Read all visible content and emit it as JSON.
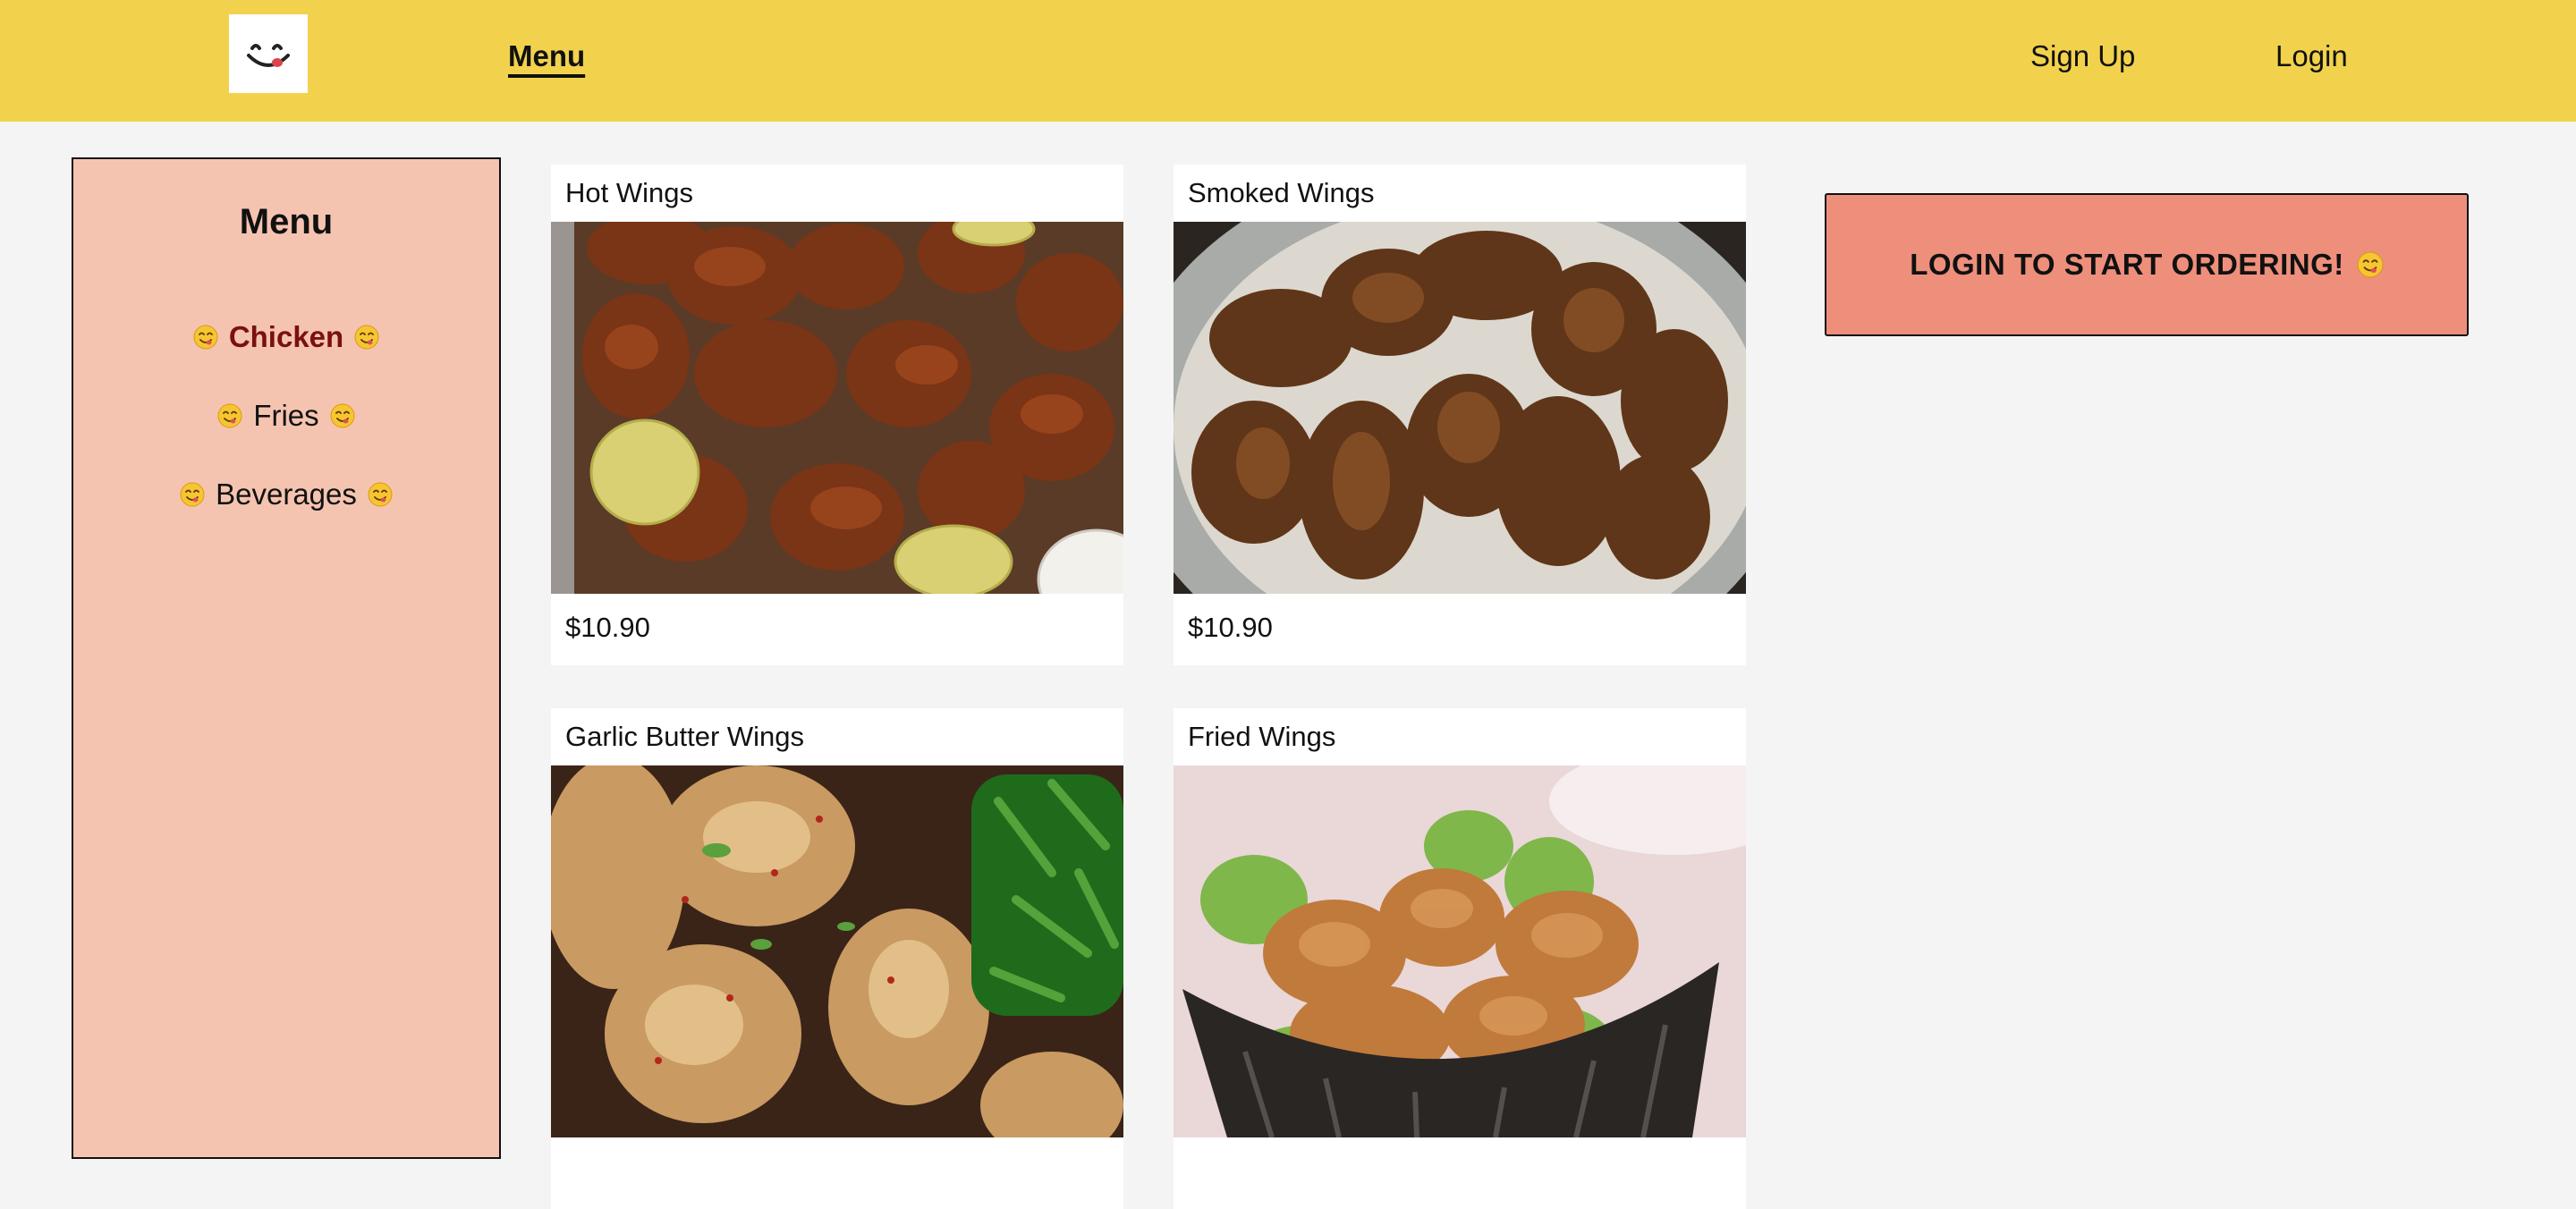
{
  "header": {
    "logo_icon": "smiling-face-logo-icon",
    "menu_label": "Menu",
    "signup_label": "Sign Up",
    "login_label": "Login",
    "background_color": "#f2d24c"
  },
  "sidebar": {
    "title": "Menu",
    "background_color": "#f5c4b0",
    "active_color": "#7a1012",
    "items": [
      {
        "label": "Chicken",
        "icon": "yum-emoji-icon",
        "active": true
      },
      {
        "label": "Fries",
        "icon": "yum-emoji-icon",
        "active": false
      },
      {
        "label": "Beverages",
        "icon": "yum-emoji-icon",
        "active": false
      }
    ]
  },
  "products": [
    {
      "name": "Hot Wings",
      "price": "$10.90",
      "photo": "hot-wings-photo"
    },
    {
      "name": "Smoked Wings",
      "price": "$10.90",
      "photo": "smoked-wings-photo"
    },
    {
      "name": "Garlic Butter Wings",
      "price": "",
      "photo": "garlic-butter-wings-photo"
    },
    {
      "name": "Fried Wings",
      "price": "",
      "photo": "fried-wings-photo"
    }
  ],
  "cta": {
    "label": "LOGIN TO START ORDERING!",
    "icon": "yum-emoji-icon",
    "background_color": "#ee8f7c"
  }
}
